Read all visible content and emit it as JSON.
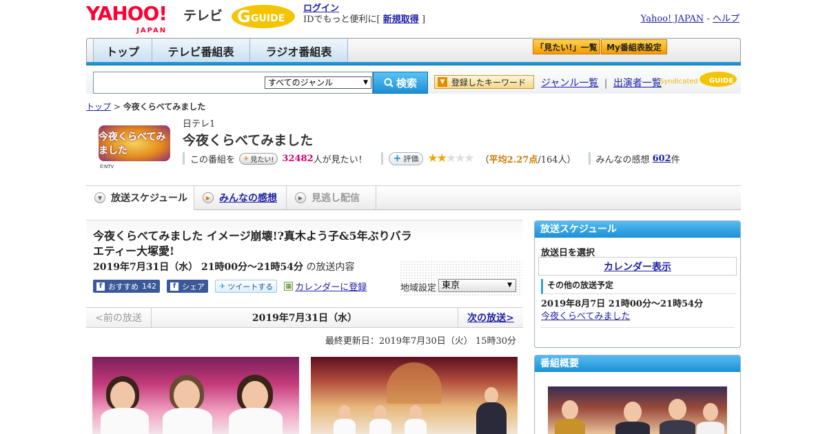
{
  "header": {
    "logo_yahoo": "YAHOO!",
    "logo_japan": "JAPAN",
    "logo_tv": "テレビ",
    "logo_gguide": "GUIDE",
    "login_link": "ログイン",
    "login_hint": "IDでもっと便利に[",
    "register_link": "新規取得",
    "login_hint_end": "]",
    "yahoo_japan_link": "Yahoo! JAPAN",
    "separator": "-",
    "help_link": "ヘルプ"
  },
  "nav": {
    "tabs": [
      {
        "label": "トップ"
      },
      {
        "label": "テレビ番組表"
      },
      {
        "label": "ラジオ番組表"
      }
    ],
    "mitai_list_button": "「見たい!」一覧",
    "my_schedule_button": "My番組表設定"
  },
  "search": {
    "genre_selected": "すべてのジャンル",
    "button_label": "検索",
    "keyword_button": "登録したキーワード",
    "genre_list_link": "ジャンル一覧",
    "separator": "|",
    "cast_list_link": "出演者一覧",
    "syndicated_label": "Syndicated",
    "syndicated_brand": "GUIDE"
  },
  "breadcrumb": {
    "home": "トップ",
    "separator": ">",
    "current": "今夜くらべてみました"
  },
  "program": {
    "logo_text": "今夜くらべてみました",
    "copyright": "©NTV",
    "station": "日テレ1",
    "title": "今夜くらべてみました",
    "mitai_prefix": "この番組を",
    "mitai_button": "見たい!",
    "mitai_count": "32482",
    "mitai_suffix": "人が見たい！",
    "eval_button": "評価",
    "rating_stars": 2.27,
    "rating_open": "（",
    "rating_avg_label": "平均2.27点",
    "rating_count": "/164人）",
    "impressions_prefix": "みんなの感想",
    "impressions_count": "602",
    "impressions_suffix": "件"
  },
  "subtabs": {
    "schedule": "放送スケジュール",
    "impressions": "みんなの感想",
    "missed": "見逃し配信"
  },
  "episode": {
    "title": "今夜くらべてみました イメージ崩壊!?真木よう子&5年ぶりバラエティー大塚愛!",
    "datetime": "2019年7月31日（水） 21時00分～21時54分",
    "datetime_suffix": "の放送内容",
    "fb_recommend": "おすすめ",
    "fb_recommend_count": "142",
    "fb_share": "シェア",
    "tweet": "ツイートする",
    "calendar_register": "カレンダーに登録",
    "region_label": "地域設定",
    "region_value": "東京"
  },
  "broadcast_nav": {
    "prev": "<前の放送",
    "current_date": "2019年7月31日（水）",
    "next": "次の放送>"
  },
  "last_updated": "最終更新日：2019年7月30日（火） 15時30分",
  "sidebar": {
    "schedule_header": "放送スケジュール",
    "select_date_label": "放送日を選択",
    "calendar_link": "カレンダー表示",
    "other_schedule_label": "その他の放送予定",
    "other_date": "2019年8月7日 21時00分～21時54分",
    "other_title": "今夜くらべてみました",
    "summary_header": "番組概要"
  },
  "colors": {
    "accent_blue": "#1e95d8",
    "link": "#1d1fa3",
    "pink_count": "#d4006f",
    "star": "#f4a300",
    "yahoo_red": "#ff0033"
  }
}
